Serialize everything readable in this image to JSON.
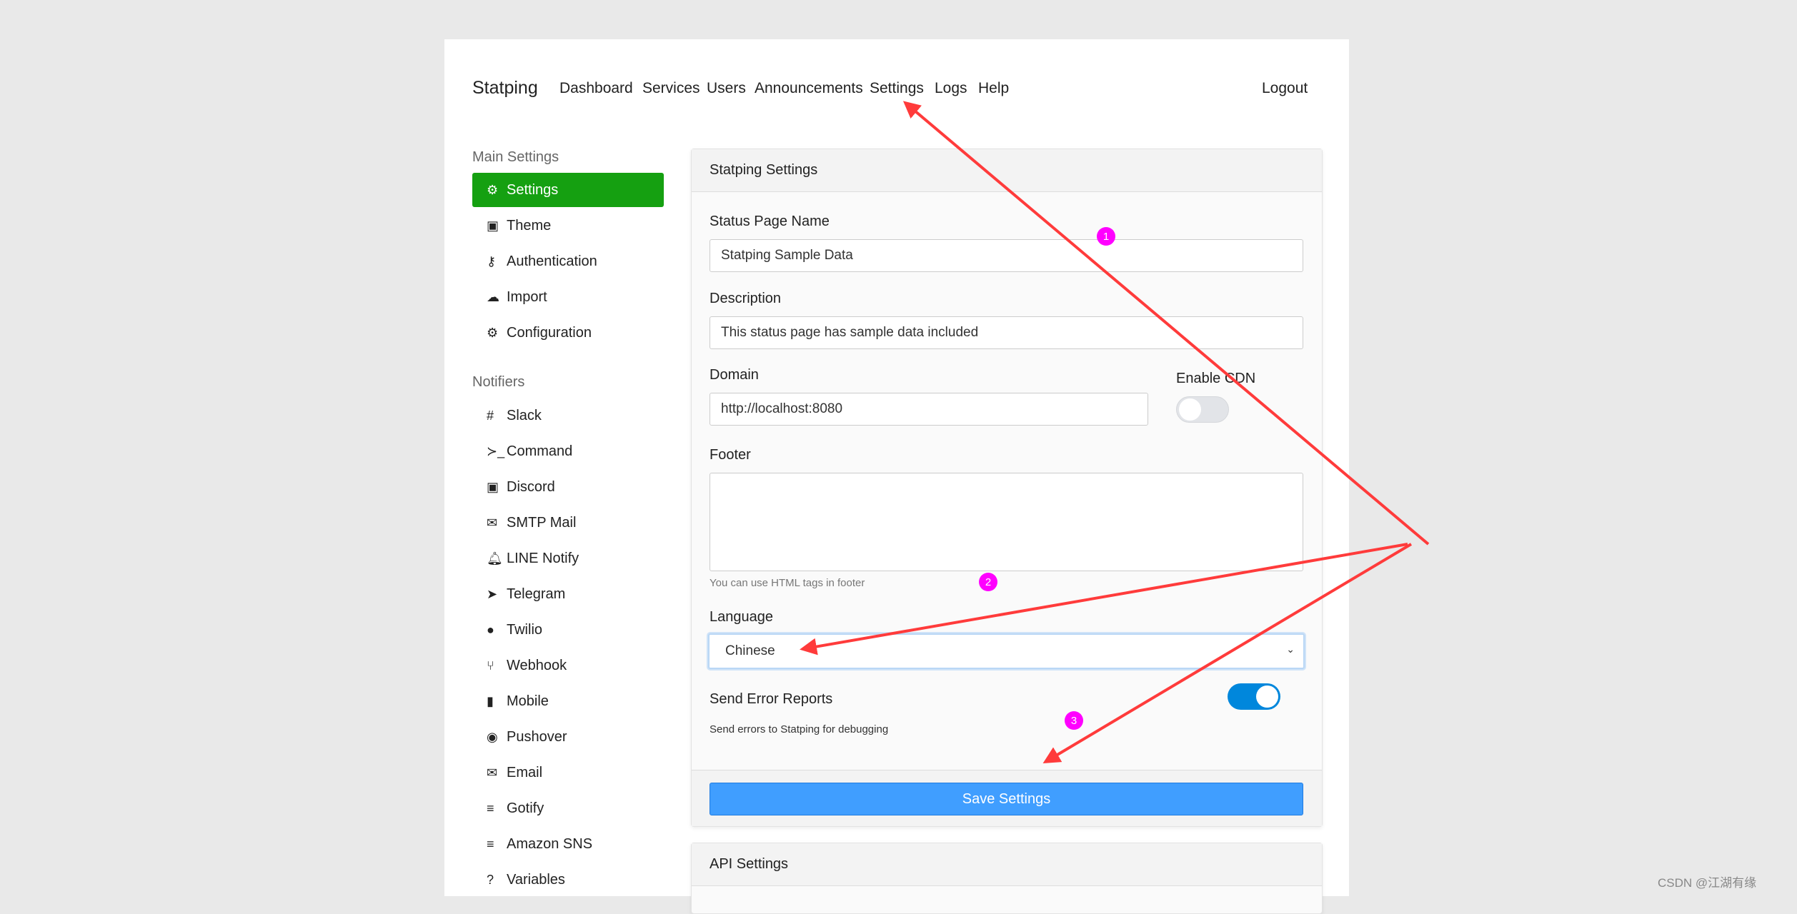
{
  "nav": {
    "brand": "Statping",
    "items": [
      "Dashboard",
      "Services",
      "Users",
      "Announcements",
      "Settings",
      "Logs",
      "Help"
    ],
    "logout": "Logout"
  },
  "sidebar": {
    "main_heading": "Main Settings",
    "main_items": [
      {
        "label": "Settings",
        "icon": "gear-icon",
        "active": true
      },
      {
        "label": "Theme",
        "icon": "image-icon"
      },
      {
        "label": "Authentication",
        "icon": "key-icon"
      },
      {
        "label": "Import",
        "icon": "cloud-download-icon"
      },
      {
        "label": "Configuration",
        "icon": "gears-icon"
      }
    ],
    "notifiers_heading": "Notifiers",
    "notifiers": [
      {
        "label": "Slack",
        "icon": "slack-icon"
      },
      {
        "label": "Command",
        "icon": "terminal-icon"
      },
      {
        "label": "Discord",
        "icon": "discord-icon"
      },
      {
        "label": "SMTP Mail",
        "icon": "envelope-icon"
      },
      {
        "label": "LINE Notify",
        "icon": "bell-icon"
      },
      {
        "label": "Telegram",
        "icon": "paper-plane-icon"
      },
      {
        "label": "Twilio",
        "icon": "comment-icon"
      },
      {
        "label": "Webhook",
        "icon": "code-branch-icon"
      },
      {
        "label": "Mobile",
        "icon": "mobile-icon"
      },
      {
        "label": "Pushover",
        "icon": "dot-circle-icon"
      },
      {
        "label": "Email",
        "icon": "envelope-open-icon"
      },
      {
        "label": "Gotify",
        "icon": "bars-icon"
      },
      {
        "label": "Amazon SNS",
        "icon": "bars-icon"
      },
      {
        "label": "Variables",
        "icon": "question-icon"
      }
    ]
  },
  "settings": {
    "title": "Statping Settings",
    "name_label": "Status Page Name",
    "name_value": "Statping Sample Data",
    "desc_label": "Description",
    "desc_value": "This status page has sample data included",
    "domain_label": "Domain",
    "domain_value": "http://localhost:8080",
    "cdn_label": "Enable CDN",
    "cdn_enabled": false,
    "footer_label": "Footer",
    "footer_value": "",
    "footer_hint": "You can use HTML tags in footer",
    "language_label": "Language",
    "language_value": "Chinese",
    "error_label": "Send Error Reports",
    "error_hint": "Send errors to Statping for debugging",
    "error_enabled": true,
    "save_label": "Save Settings"
  },
  "api": {
    "title": "API Settings"
  },
  "annotations": {
    "badges": [
      "1",
      "2",
      "3"
    ],
    "color": "#ff3b3b",
    "badge_color": "#ff00ff"
  },
  "watermark": "CSDN @江湖有缘",
  "colors": {
    "active": "#15a011",
    "primary": "#409eff",
    "toggle_on": "#0087dc"
  }
}
